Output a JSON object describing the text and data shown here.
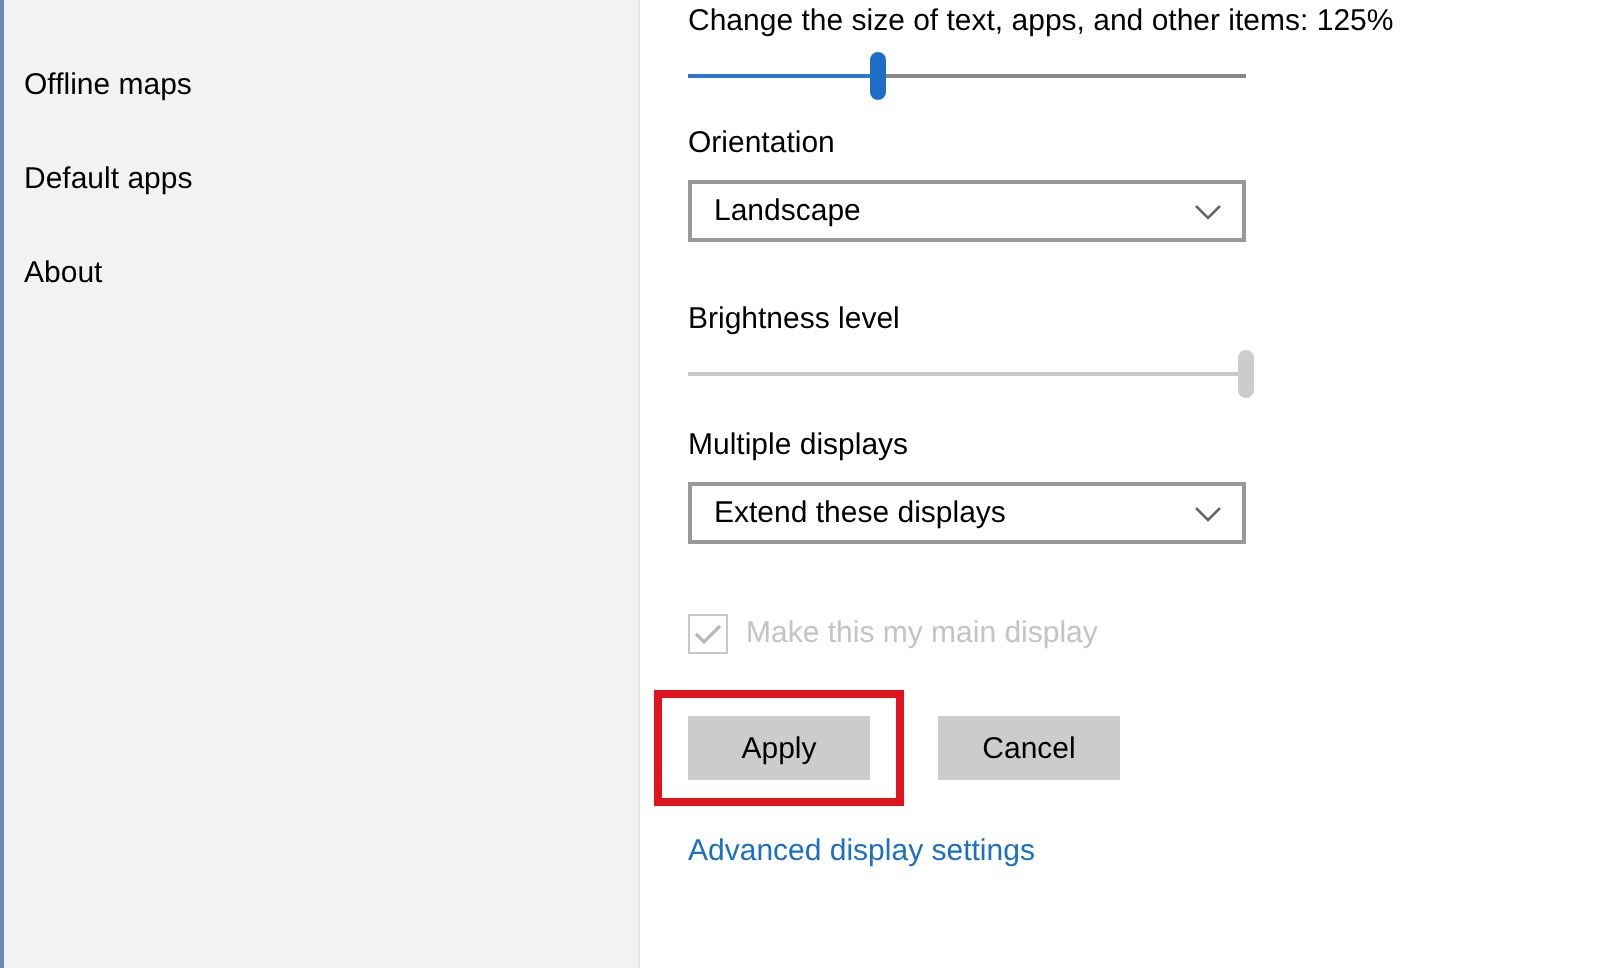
{
  "sidebar": {
    "items": [
      {
        "label": "Offline maps",
        "selected": false
      },
      {
        "label": "Default apps",
        "selected": false
      },
      {
        "label": "About",
        "selected": false
      }
    ]
  },
  "scale": {
    "label": "Change the size of text, apps, and other items: 125%",
    "level": 0.34,
    "disabled": false
  },
  "orientation": {
    "label": "Orientation",
    "value": "Landscape"
  },
  "brightness": {
    "label": "Brightness level",
    "level": 1.0,
    "disabled": true
  },
  "multiple_displays": {
    "label": "Multiple displays",
    "value": "Extend these displays"
  },
  "main_display": {
    "label": "Make this my main display",
    "checked": true,
    "disabled": true
  },
  "buttons": [
    {
      "label": "Apply",
      "highlighted": true
    },
    {
      "label": "Cancel",
      "highlighted": false
    }
  ],
  "link": "Advanced display settings"
}
